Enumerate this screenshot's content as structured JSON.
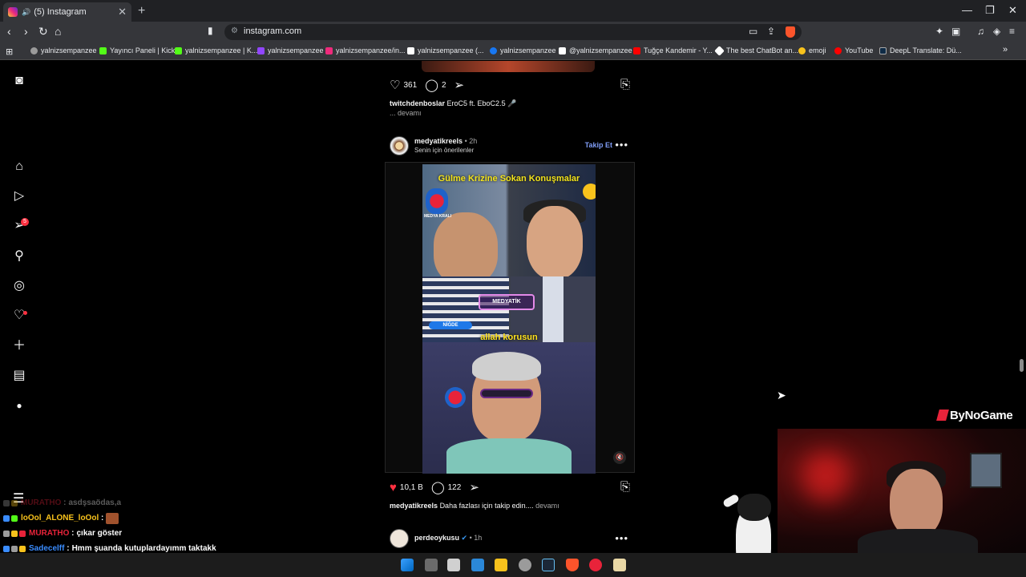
{
  "browser": {
    "tab_title": "(5) Instagram",
    "new_tab": "+",
    "url": "instagram.com",
    "bookmarks": [
      {
        "label": "yalnizsempanzee",
        "color": "#9b9b9b"
      },
      {
        "label": "Yayıncı Paneli | Kick",
        "color": "#53fc18"
      },
      {
        "label": "yalnizsempanzee | K...",
        "color": "#53fc18"
      },
      {
        "label": "yalnizsempanzee",
        "color": "#9146ff"
      },
      {
        "label": "yalnizsempanzee/in...",
        "color": "#ee2a7b"
      },
      {
        "label": "yalnizsempanzee (...",
        "color": "#ffffff"
      },
      {
        "label": "yalnizsempanzee",
        "color": "#1877f2"
      },
      {
        "label": "@yalnizsempanzee",
        "color": "#ffffff"
      },
      {
        "label": "Tuğçe Kandemir - Y...",
        "color": "#ff0000"
      },
      {
        "label": "The best ChatBot an...",
        "color": "#ffffff"
      },
      {
        "label": "emoji",
        "color": "#f8c21c"
      },
      {
        "label": "YouTube",
        "color": "#ff0000"
      },
      {
        "label": "DeepL Translate: Dü...",
        "color": "#0f2b46"
      }
    ]
  },
  "sidebar": {
    "notification_count": "5"
  },
  "posts": [
    {
      "likes": "361",
      "comments": "2",
      "username": "twitchdenboslar",
      "caption": "EroC5 ft. EboC2.5 🎤",
      "more": "... devamı"
    },
    {
      "username": "medyatikreels",
      "time": "• 2h",
      "subtitle": "Senin için önerilenler",
      "follow_label": "Takip Et",
      "video_title": "Gülme Krizine Sokan Konuşmalar",
      "video_logo": "MEDYA KRALI",
      "video_watermark": "MEDYATİK",
      "video_badge": "NİĞDE",
      "video_caption": "allah korusun",
      "likes": "10,1 B",
      "comments": "122",
      "caption": "Daha fazlası için takip edin....",
      "more": "devamı"
    },
    {
      "username": "perdeoykusu",
      "time": "• 1h"
    }
  ],
  "overlay": {
    "brand": "ByNoGame",
    "chat": [
      {
        "user": "MURATHO",
        "text": "asdşsaödas,a",
        "color": "#e8233a",
        "faded": true
      },
      {
        "user": "loOol_ALONE_loOol",
        "text": "",
        "color": "#f8c21c",
        "faded": false
      },
      {
        "user": "MURATHO",
        "text": "çıkar göster",
        "color": "#e8233a",
        "faded": false
      },
      {
        "user": "Sadecelff",
        "text": "Hmm şuanda kutuplardayımm taktakk",
        "color": "#3a8cff",
        "faded": false
      }
    ]
  },
  "colors": {
    "accent_follow": "#7f9cf5",
    "like_red": "#ff3040"
  }
}
